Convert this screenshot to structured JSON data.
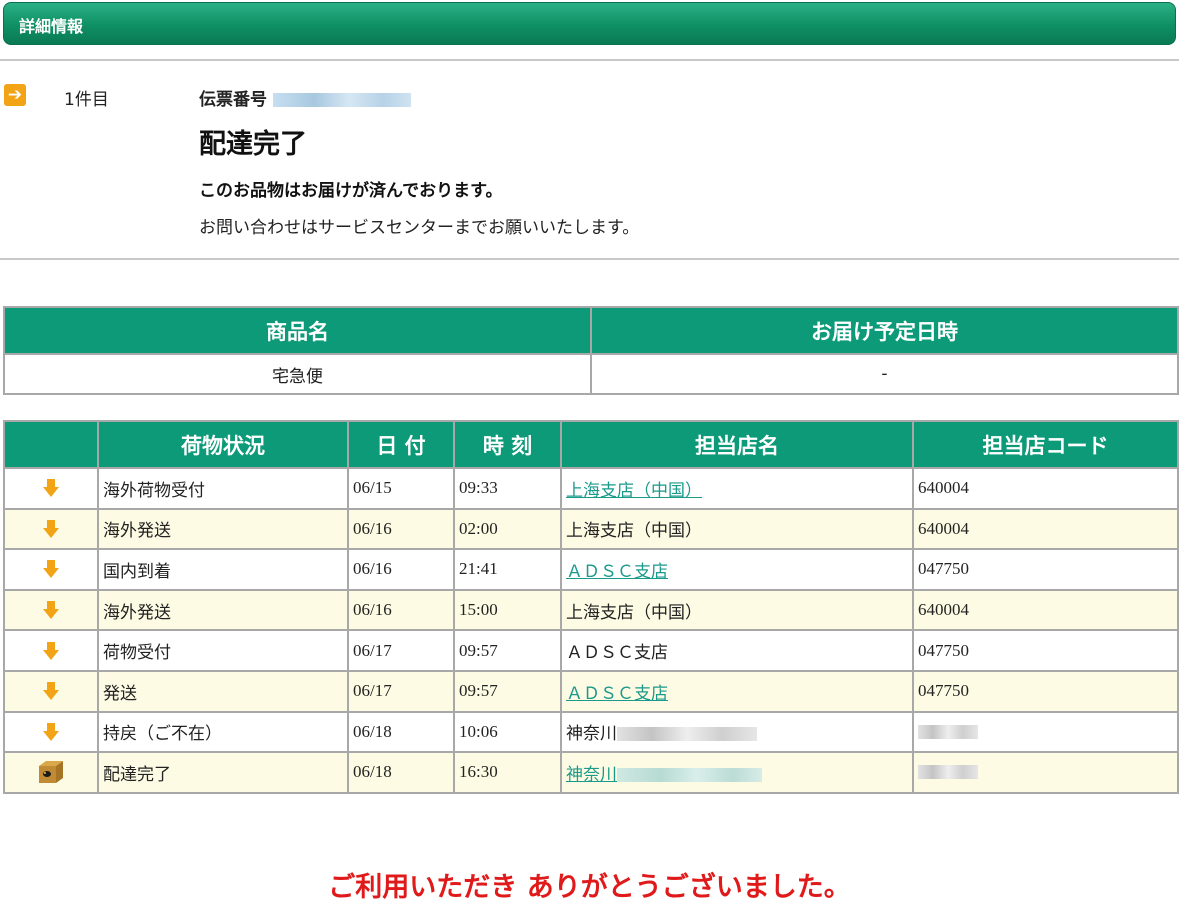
{
  "header": {
    "title": "詳細情報"
  },
  "shipment": {
    "count_label": "1件目",
    "slip_label": "伝票番号",
    "status_title": "配達完了",
    "status_message": "このお品物はお届けが済んでおります。",
    "status_note": "お問い合わせはサービスセンターまでお願いいたします。"
  },
  "product_table": {
    "headers": [
      "商品名",
      "お届け予定日時"
    ],
    "row": [
      "宅急便",
      "-"
    ]
  },
  "history_table": {
    "headers": [
      "荷物状況",
      "日 付",
      "時 刻",
      "担当店名",
      "担当店コード"
    ],
    "rows": [
      {
        "status": "海外荷物受付",
        "date": "06/15",
        "time": "09:33",
        "store": "上海支店（中国）",
        "code": "640004"
      },
      {
        "status": "海外発送",
        "date": "06/16",
        "time": "02:00",
        "store": "上海支店（中国）",
        "code": "640004"
      },
      {
        "status": "国内到着",
        "date": "06/16",
        "time": "21:41",
        "store": "ＡＤＳＣ支店",
        "code": "047750"
      },
      {
        "status": "海外発送",
        "date": "06/16",
        "time": "15:00",
        "store": "上海支店（中国）",
        "code": "640004"
      },
      {
        "status": "荷物受付",
        "date": "06/17",
        "time": "09:57",
        "store": "ＡＤＳＣ支店",
        "code": "047750"
      },
      {
        "status": "発送",
        "date": "06/17",
        "time": "09:57",
        "store": "ＡＤＳＣ支店",
        "code": "047750"
      },
      {
        "status": "持戻（ご不在）",
        "date": "06/18",
        "time": "10:06",
        "store": "神奈川",
        "code": ""
      },
      {
        "status": "配達完了",
        "date": "06/18",
        "time": "16:30",
        "store": "神奈川",
        "code": ""
      }
    ]
  },
  "footer": {
    "thanks": "ご利用いただき ありがとうございました。"
  },
  "icons": {
    "row_arrow": "arrow-down-icon",
    "delivered": "package-box-icon",
    "item_marker": "arrow-right-icon"
  },
  "colors": {
    "header_green": "#0c9a78",
    "arrow_orange": "#f2a416",
    "link_teal": "#1a9a8a",
    "thanks_red": "#e01a1a",
    "alt_row": "#fdfbe3"
  }
}
